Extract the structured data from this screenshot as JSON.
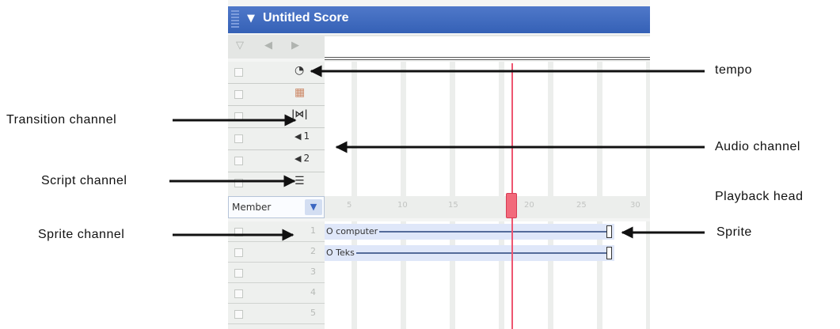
{
  "window": {
    "title": "Untitled Score",
    "title_glyph": "▼",
    "nav_glyphs": [
      "▽",
      "◀",
      "▶"
    ]
  },
  "channels": [
    {
      "name": "tempo",
      "icon": "◔",
      "number": ""
    },
    {
      "name": "palette",
      "icon": "▦",
      "number": ""
    },
    {
      "name": "transition",
      "icon": "|⋈|",
      "number": ""
    },
    {
      "name": "sound-1",
      "icon": "◀",
      "number": "1"
    },
    {
      "name": "sound-2",
      "icon": "◀",
      "number": "2"
    },
    {
      "name": "script",
      "icon": "☰",
      "number": ""
    }
  ],
  "member_selector": {
    "value": "Member",
    "arrow": "▼"
  },
  "frame_ruler": [
    "5",
    "10",
    "15",
    "20",
    "25",
    "30"
  ],
  "sprite_channels": [
    "1",
    "2",
    "3",
    "4",
    "5"
  ],
  "sprites": [
    {
      "label": "O computer"
    },
    {
      "label": "O Teks"
    }
  ],
  "annotations": {
    "tempo": "tempo",
    "transition": "Transition channel",
    "audio": "Audio channel",
    "script": "Script channel",
    "playback_head": "Playback head",
    "sprite_channel": "Sprite channel",
    "sprite": "Sprite"
  },
  "colors": {
    "title_bar": "#3a65bb",
    "playback_head": "#ee5570",
    "sprite_bar": "#dfe7f9"
  }
}
